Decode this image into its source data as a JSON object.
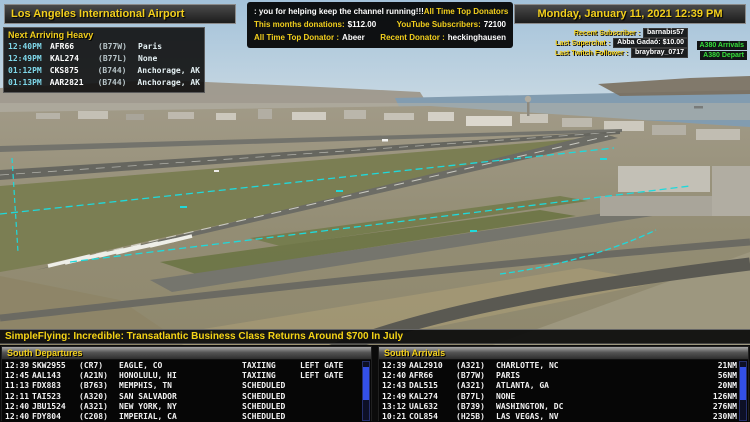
{
  "header": {
    "airport_title": "Los Angeles International Airport",
    "datetime": "Monday, January 11, 2021 12:39 PM"
  },
  "donations": {
    "thanks_text": ": you for helping keep the channel running!!!",
    "top_donators_heading": "All Time Top Donators",
    "month_label": "This months donations:",
    "month_value": "$112.00",
    "subs_label": "YouTube Subscribers:",
    "subs_value": "72100",
    "top_donator_label": "All Time Top Donator :",
    "top_donator_value": "Abeer",
    "recent_donator_label": "Recent Donator :",
    "recent_donator_value": "heckinghausen"
  },
  "social": {
    "recent_subscriber_label": "Recent Subscriber :",
    "recent_subscriber_value": "barnabis57",
    "last_superchat_label": "Last Superchat :",
    "last_superchat_value": "Abba Gadaó: $10.00",
    "last_twitch_label": "Last Twitch Follower :",
    "last_twitch_value": "braybray_0717"
  },
  "badges": {
    "a380_arrivals": "A380 Arrivals",
    "a380_depart": "A380 Depart"
  },
  "next_heavy": {
    "title": "Next Arriving Heavy",
    "rows": [
      {
        "time": "12:40PM",
        "callsign": "AFR66",
        "type": "(B77W)",
        "city": "Paris"
      },
      {
        "time": "12:49PM",
        "callsign": "KAL274",
        "type": "(B77L)",
        "city": "None"
      },
      {
        "time": "01:12PM",
        "callsign": "CKS875",
        "type": "(B744)",
        "city": "Anchorage, AK"
      },
      {
        "time": "01:13PM",
        "callsign": "AAR2821",
        "type": "(B744)",
        "city": "Anchorage, AK"
      }
    ]
  },
  "ticker": "SimpleFlying: Incredible: Transatlantic Business Class Returns Around $700 In July",
  "departures": {
    "title": "South Departures",
    "rows": [
      {
        "time": "12:39",
        "callsign": "SKW2955",
        "type": "(CR7)",
        "city": "EAGLE, CO",
        "status": "TAXIING",
        "gate": "LEFT GATE"
      },
      {
        "time": "12:45",
        "callsign": "AAL143",
        "type": "(A21N)",
        "city": "HONOLULU, HI",
        "status": "TAXIING",
        "gate": "LEFT GATE"
      },
      {
        "time": "11:13",
        "callsign": "FDX883",
        "type": "(B763)",
        "city": "MEMPHIS, TN",
        "status": "SCHEDULED",
        "gate": ""
      },
      {
        "time": "12:11",
        "callsign": "TAI523",
        "type": "(A320)",
        "city": "SAN SALVADOR",
        "status": "SCHEDULED",
        "gate": ""
      },
      {
        "time": "12:40",
        "callsign": "JBU1524",
        "type": "(A321)",
        "city": "NEW YORK, NY",
        "status": "SCHEDULED",
        "gate": ""
      },
      {
        "time": "12:40",
        "callsign": "FDY804",
        "type": "(C208)",
        "city": "IMPERIAL, CA",
        "status": "SCHEDULED",
        "gate": ""
      }
    ]
  },
  "arrivals": {
    "title": "South Arrivals",
    "rows": [
      {
        "time": "12:39",
        "callsign": "AAL2910",
        "type": "(A321)",
        "city": "CHARLOTTE, NC",
        "distance": "21NM"
      },
      {
        "time": "12:40",
        "callsign": "AFR66",
        "type": "(B77W)",
        "city": "PARIS",
        "distance": "56NM"
      },
      {
        "time": "12:43",
        "callsign": "DAL515",
        "type": "(A321)",
        "city": "ATLANTA, GA",
        "distance": "20NM"
      },
      {
        "time": "12:49",
        "callsign": "KAL274",
        "type": "(B77L)",
        "city": "NONE",
        "distance": "126NM"
      },
      {
        "time": "13:12",
        "callsign": "UAL632",
        "type": "(B739)",
        "city": "WASHINGTON, DC",
        "distance": "276NM"
      },
      {
        "time": "10:21",
        "callsign": "COL854",
        "type": "(H25B)",
        "city": "LAS VEGAS, NV",
        "distance": "230NM"
      }
    ]
  },
  "colors": {
    "accent_yellow": "#f2cf1d",
    "cyan_overlay": "#1fd9db",
    "badge_green": "#35e03a",
    "scrollbar_blue": "#3350e8"
  }
}
